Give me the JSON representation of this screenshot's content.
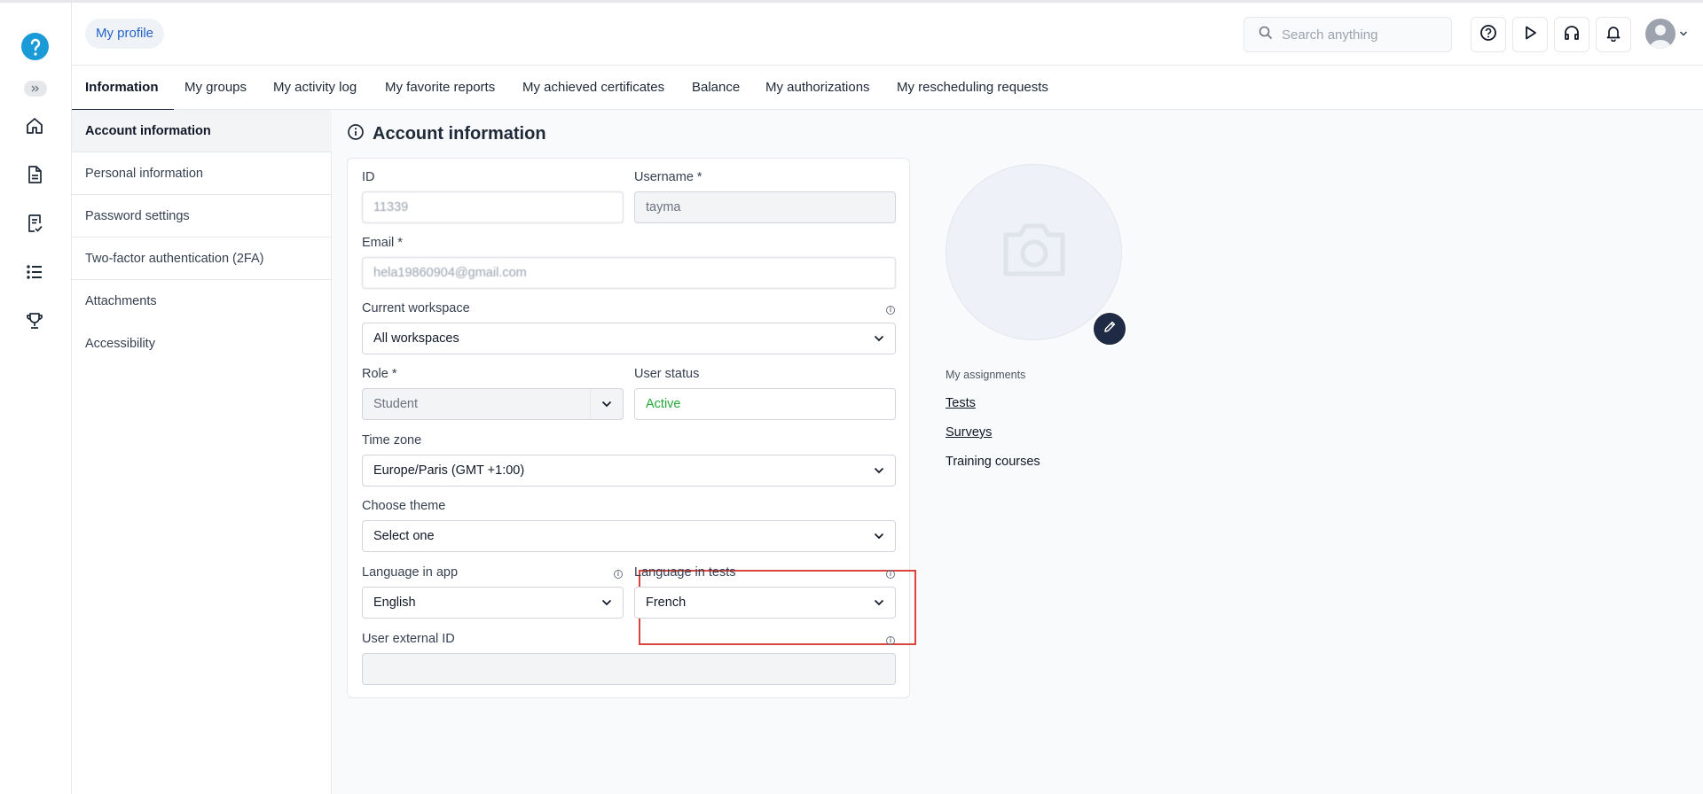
{
  "header": {
    "breadcrumb": "My profile",
    "search_placeholder": "Search anything"
  },
  "tabs": [
    {
      "label": "Information"
    },
    {
      "label": "My groups"
    },
    {
      "label": "My activity log"
    },
    {
      "label": "My favorite reports"
    },
    {
      "label": "My achieved certificates"
    },
    {
      "label": "Balance"
    },
    {
      "label": "My authorizations"
    },
    {
      "label": "My rescheduling requests"
    }
  ],
  "sidemenu": [
    {
      "label": "Account information"
    },
    {
      "label": "Personal information"
    },
    {
      "label": "Password settings"
    },
    {
      "label": "Two-factor authentication (2FA)"
    },
    {
      "label": "Attachments"
    },
    {
      "label": "Accessibility"
    }
  ],
  "page": {
    "title": "Account information"
  },
  "form": {
    "id_label": "ID",
    "id_value": "11339",
    "username_label": "Username *",
    "username_value": "tayma",
    "email_label": "Email *",
    "email_value": "hela19860904@gmail.com",
    "workspace_label": "Current workspace",
    "workspace_value": "All workspaces",
    "role_label": "Role *",
    "role_value": "Student",
    "status_label": "User status",
    "status_value": "Active",
    "timezone_label": "Time zone",
    "timezone_value": "Europe/Paris (GMT +1:00)",
    "theme_label": "Choose theme",
    "theme_value": "Select one",
    "lang_app_label": "Language in app",
    "lang_app_value": "English",
    "lang_tests_label": "Language in tests",
    "lang_tests_value": "French",
    "external_id_label": "User external ID",
    "external_id_value": ""
  },
  "assignments": {
    "heading": "My assignments",
    "tests": "Tests",
    "surveys": "Surveys",
    "training": "Training courses"
  },
  "colors": {
    "accent": "#1f2a44",
    "logo": "#1a9ad6",
    "active_status": "#22a83a",
    "highlight": "#d9453c"
  }
}
